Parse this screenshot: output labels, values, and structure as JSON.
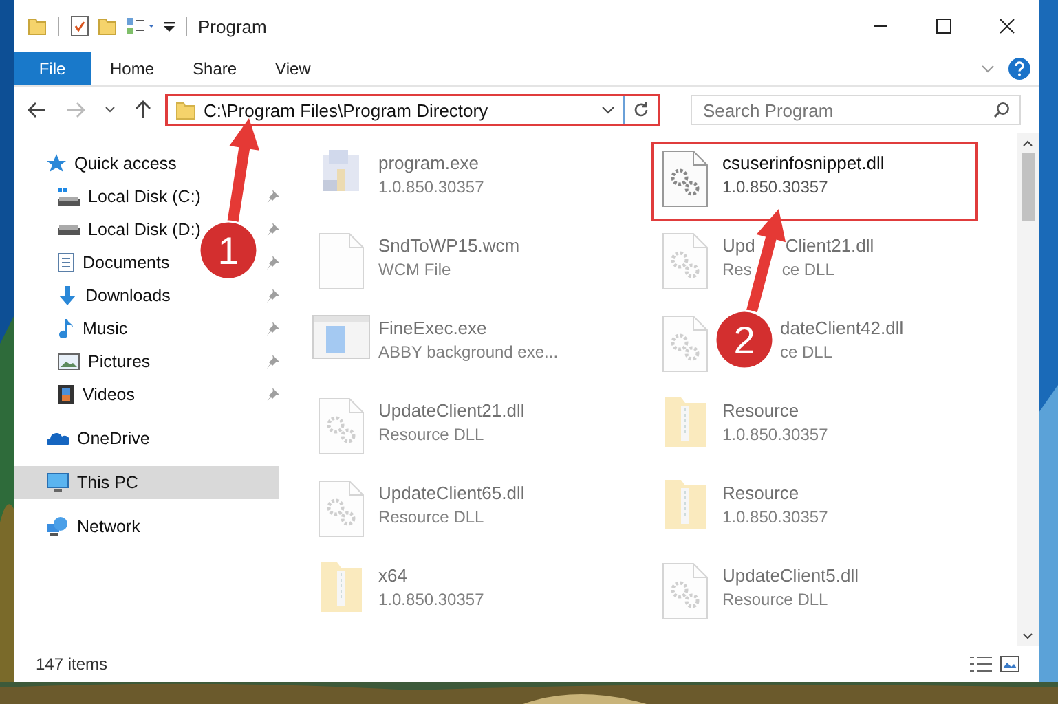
{
  "window": {
    "title": "Program"
  },
  "ribbon_tabs": [
    {
      "label": "File",
      "kind": "menu"
    },
    {
      "label": "Home",
      "kind": "tab"
    },
    {
      "label": "Share",
      "kind": "tab"
    },
    {
      "label": "View",
      "kind": "tab"
    }
  ],
  "address_bar": {
    "path": "C:\\Program Files\\Program Directory",
    "highlighted": true
  },
  "search": {
    "placeholder": "Search Program"
  },
  "sidebar": {
    "items": [
      {
        "label": "Quick access",
        "selected": false,
        "children": [
          {
            "label": "Local Disk (C:)",
            "pinned": true
          },
          {
            "label": "Local Disk (D:)",
            "pinned": true
          },
          {
            "label": "Documents",
            "pinned": true
          },
          {
            "label": "Downloads",
            "pinned": true
          },
          {
            "label": "Music",
            "pinned": true
          },
          {
            "label": "Pictures",
            "pinned": true
          },
          {
            "label": "Videos",
            "pinned": true
          }
        ]
      },
      {
        "label": "OneDrive",
        "selected": false
      },
      {
        "label": "This PC",
        "selected": true
      },
      {
        "label": "Network",
        "selected": false
      }
    ]
  },
  "files": [
    {
      "name": "program.exe",
      "detail": "1.0.850.30357",
      "kind": "exe",
      "highlighted": false
    },
    {
      "name": "csuserinfosnippet.dll",
      "detail": "1.0.850.30357",
      "kind": "dll",
      "highlighted": true
    },
    {
      "name": "SndToWP15.wcm",
      "detail": "WCM File",
      "kind": "file",
      "highlighted": false
    },
    {
      "name_head": "Upd",
      "name_tail": "Client21.dll",
      "detail_head": "Res",
      "detail_tail": "ce DLL",
      "kind": "dll",
      "highlighted": false
    },
    {
      "name": "FineExec.exe",
      "detail": "ABBY background exe...",
      "kind": "app",
      "highlighted": false
    },
    {
      "name_tail": "dateClient42.dll",
      "detail_tail": "ce DLL",
      "kind": "dll",
      "highlighted": false
    },
    {
      "name": "UpdateClient21.dll",
      "detail": "Resource DLL",
      "kind": "dll",
      "highlighted": false
    },
    {
      "name": "Resource",
      "detail": "1.0.850.30357",
      "kind": "folder",
      "highlighted": false
    },
    {
      "name": "UpdateClient65.dll",
      "detail": "Resource DLL",
      "kind": "dll",
      "highlighted": false
    },
    {
      "name": "Resource",
      "detail": "1.0.850.30357",
      "kind": "folder",
      "highlighted": false
    },
    {
      "name": "x64",
      "detail": "1.0.850.30357",
      "kind": "folder",
      "highlighted": false
    },
    {
      "name": "UpdateClient5.dll",
      "detail": "Resource DLL",
      "kind": "dll",
      "highlighted": false
    }
  ],
  "status_bar": {
    "count": "147 items"
  },
  "annotations": [
    {
      "label": "1"
    },
    {
      "label": "2"
    }
  ]
}
